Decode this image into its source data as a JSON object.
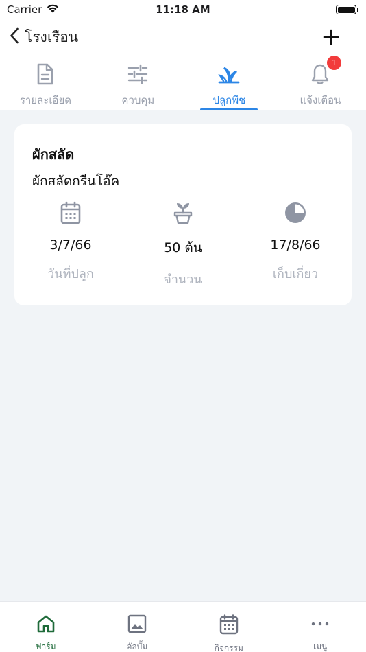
{
  "status_bar": {
    "carrier": "Carrier",
    "time": "11:18 AM"
  },
  "nav": {
    "title": "โรงเรือน",
    "back_icon": "chevron-left-icon",
    "add_icon": "plus-icon"
  },
  "tabs": [
    {
      "label": "รายละเอียด",
      "icon": "document-icon",
      "active": false
    },
    {
      "label": "ควบคุม",
      "icon": "sliders-icon",
      "active": false
    },
    {
      "label": "ปลูกพืช",
      "icon": "sprout-icon",
      "active": true
    },
    {
      "label": "แจ้งเตือน",
      "icon": "bell-icon",
      "active": false,
      "badge": "1"
    }
  ],
  "card": {
    "title": "ผักสลัด",
    "subtitle": "ผักสลัดกรีนโอ๊ค",
    "stats": [
      {
        "icon": "calendar-icon",
        "value": "3/7/66",
        "label": "วันที่ปลูก"
      },
      {
        "icon": "plant-pot-icon",
        "value": "50 ต้น",
        "label": "จำนวน"
      },
      {
        "icon": "pie-clock-icon",
        "value": "17/8/66",
        "label": "เก็บเกี่ยว"
      }
    ]
  },
  "bottom_nav": [
    {
      "label": "ฟาร์ม",
      "icon": "home-icon",
      "active": true
    },
    {
      "label": "อัลบั้ม",
      "icon": "image-icon",
      "active": false
    },
    {
      "label": "กิจกรรม",
      "icon": "calendar-icon",
      "active": false
    },
    {
      "label": "เมนู",
      "icon": "more-icon",
      "active": false
    }
  ],
  "colors": {
    "accent": "#2c86e6",
    "inactive": "#9aa0ad",
    "badge": "#f23b3b",
    "farm_green": "#1f6b3a",
    "background": "#f1f4f7"
  }
}
